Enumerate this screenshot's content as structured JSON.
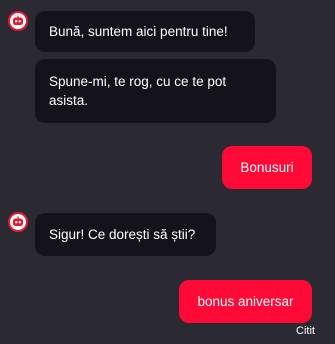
{
  "chat": {
    "bot_avatar_icon": "robot-icon",
    "messages": [
      {
        "sender": "bot",
        "text": "Bună, suntem aici pentru tine!"
      },
      {
        "sender": "bot",
        "text": "Spune-mi, te rog, cu ce te pot asista."
      },
      {
        "sender": "user",
        "text": "Bonusuri"
      },
      {
        "sender": "bot",
        "text": "Sigur! Ce dorești să știi?"
      },
      {
        "sender": "user",
        "text": "bonus aniversar"
      }
    ],
    "read_status": "Citit"
  },
  "colors": {
    "background": "#2b2a33",
    "bot_bubble": "#14131c",
    "user_bubble": "#ff0a37",
    "avatar_accent": "#e8192c"
  }
}
